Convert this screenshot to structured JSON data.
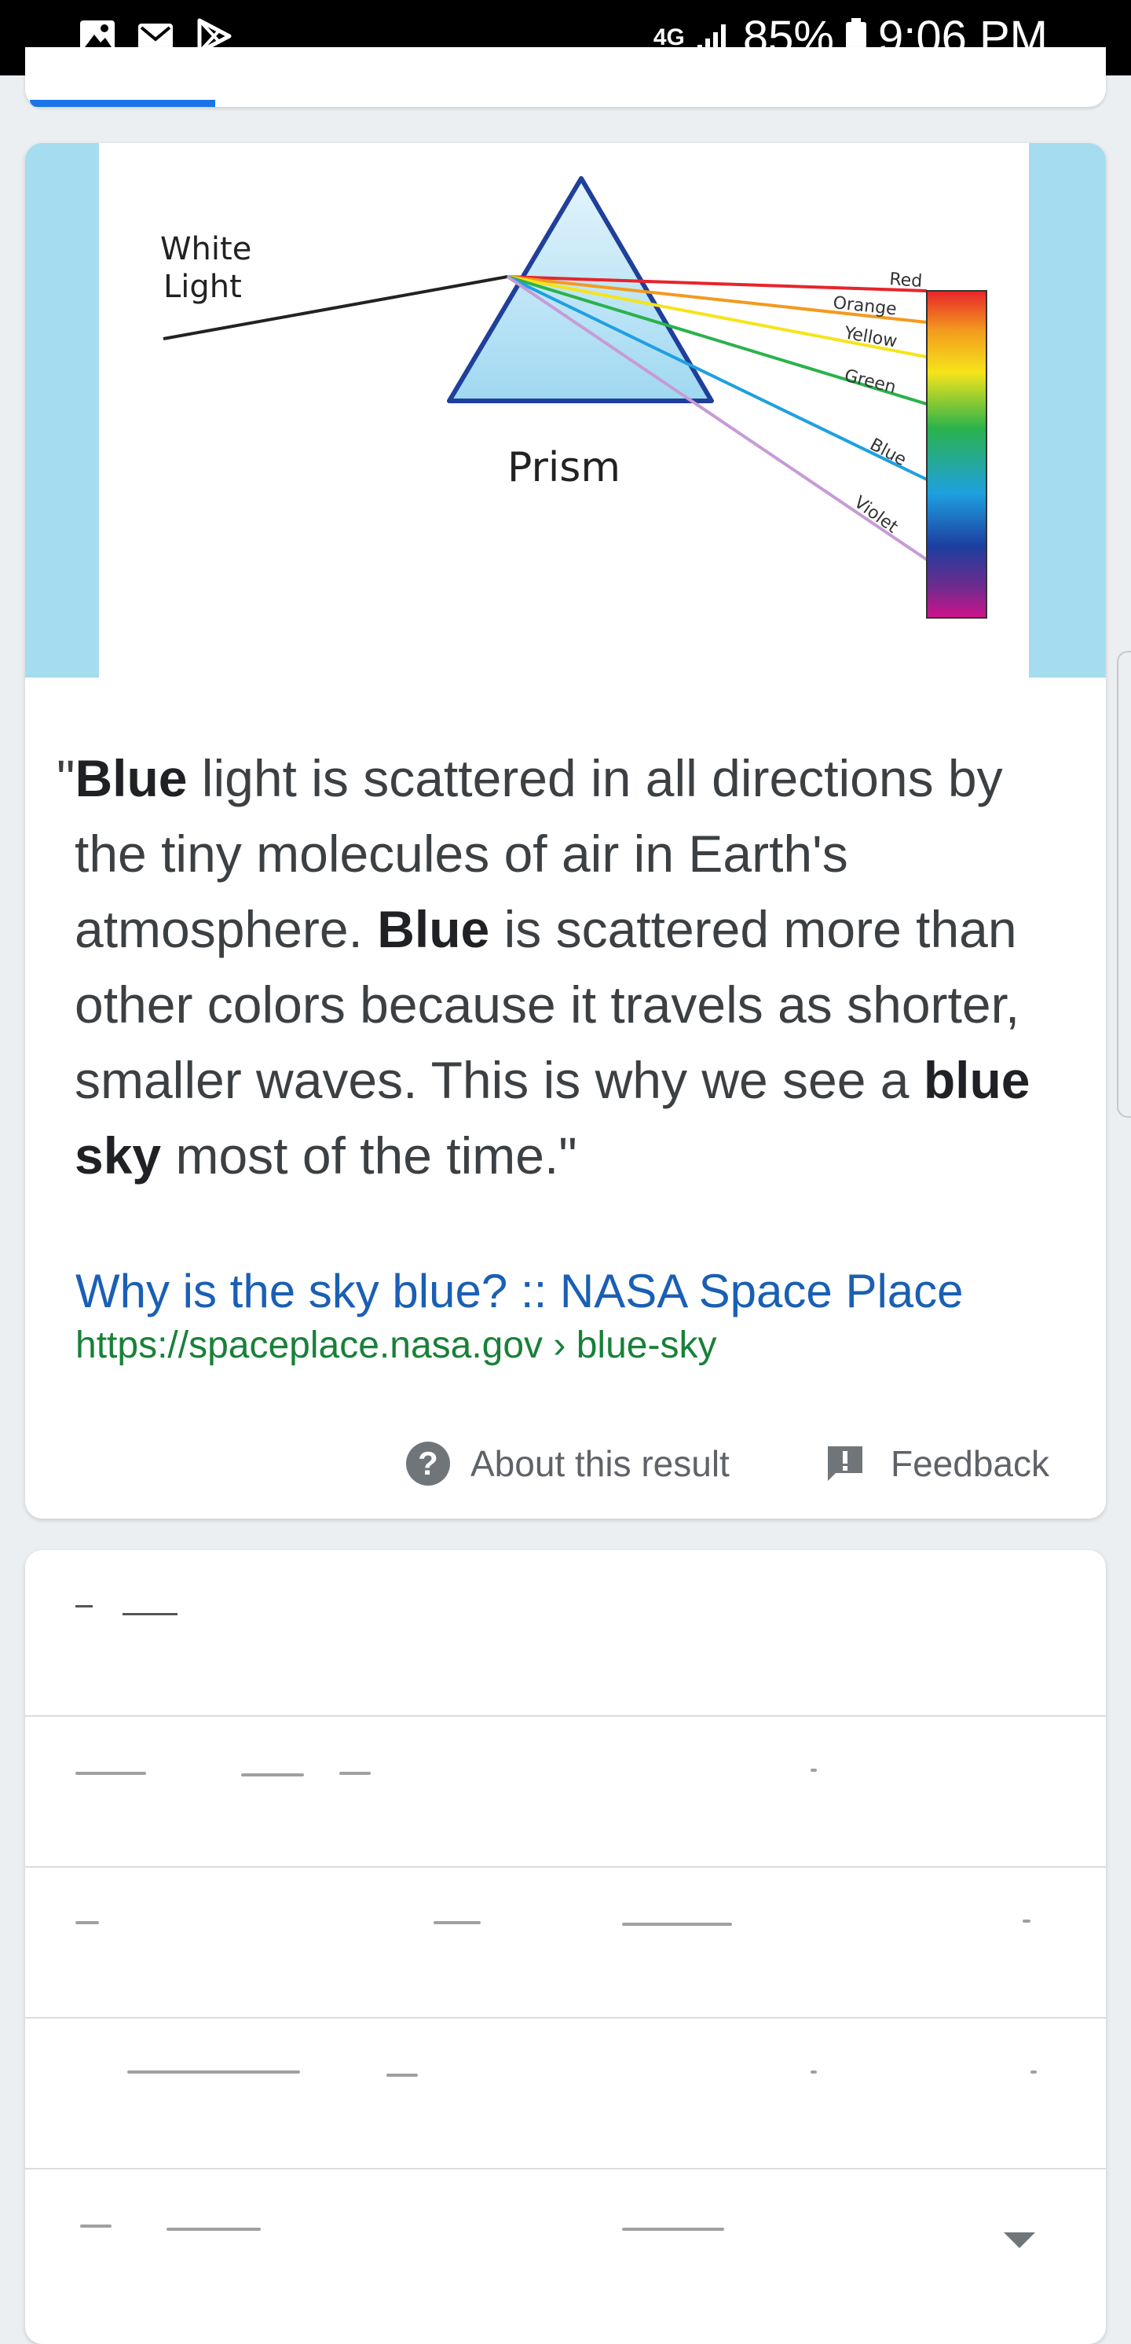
{
  "status_bar": {
    "network": "4G",
    "battery": "85%",
    "time": "9:06 PM"
  },
  "figure": {
    "input_label_line1": "White",
    "input_label_line2": "Light",
    "prism_label": "Prism",
    "bands": [
      "Red",
      "Orange",
      "Yellow",
      "Green",
      "Blue",
      "Violet"
    ],
    "band_colors": [
      "#e8242b",
      "#f39a1e",
      "#f5e41a",
      "#2bb24c",
      "#1fa0e0",
      "#c79bd6"
    ]
  },
  "snippet": {
    "q_open": "\"",
    "b1": "Blue",
    "t1": " light is scattered in all directions by the tiny molecules of air in Earth's atmosphere. ",
    "b2": "Blue",
    "t2": " is scattered more than other colors because it travels as shorter, smaller waves. This is why we see a ",
    "b3": "blue sky",
    "t3": " most of the time.\""
  },
  "source": {
    "title": "Why is the sky blue? :: NASA Space Place",
    "url": "https://spaceplace.nasa.gov › blue-sky"
  },
  "actions": {
    "about": "About this result",
    "feedback": "Feedback",
    "help_glyph": "?",
    "feedback_glyph": "!"
  },
  "colors": {
    "link": "#1a5fb4",
    "url": "#188038",
    "hero_bg": "#a6dcef",
    "accent": "#1a73e8"
  }
}
